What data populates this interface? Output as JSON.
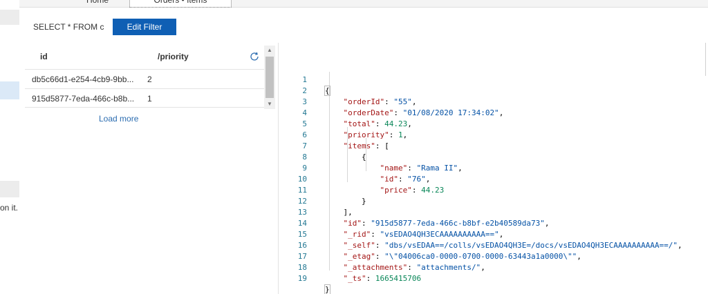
{
  "tabs": [
    {
      "label": "Home"
    },
    {
      "label": "Orders • Items"
    }
  ],
  "query": {
    "text": "SELECT * FROM c",
    "edit_filter_label": "Edit Filter"
  },
  "grid": {
    "columns": {
      "id": "id",
      "priority": "/priority"
    },
    "rows": [
      {
        "id": "db5c66d1-e254-4cb9-9bb...",
        "priority": "2"
      },
      {
        "id": "915d5877-7eda-466c-b8b...",
        "priority": "1"
      }
    ],
    "load_more": "Load more"
  },
  "left_panel": {
    "truncated_text": "on it."
  },
  "editor": {
    "lines": [
      {
        "n": "1"
      },
      {
        "n": "2"
      },
      {
        "n": "3"
      },
      {
        "n": "4"
      },
      {
        "n": "5"
      },
      {
        "n": "6"
      },
      {
        "n": "7"
      },
      {
        "n": "8"
      },
      {
        "n": "9"
      },
      {
        "n": "10"
      },
      {
        "n": "11"
      },
      {
        "n": "12"
      },
      {
        "n": "13"
      },
      {
        "n": "14"
      },
      {
        "n": "15"
      },
      {
        "n": "16"
      },
      {
        "n": "17"
      },
      {
        "n": "18"
      },
      {
        "n": "19"
      }
    ],
    "doc": {
      "orderId": "\"55\"",
      "orderDate": "\"01/08/2020 17:34:02\"",
      "total": "44.23",
      "priority": "1",
      "items_name": "\"Rama II\"",
      "items_id": "\"76\"",
      "items_price": "44.23",
      "id": "\"915d5877-7eda-466c-b8bf-e2b40589da73\"",
      "_rid": "\"vsEDAO4QH3ECAAAAAAAAAA==\"",
      "_self": "\"dbs/vsEDAA==/colls/vsEDAO4QH3E=/docs/vsEDAO4QH3ECAAAAAAAAAA==/\"",
      "_etag": "\"\\\"04006ca0-0000-0700-0000-63443a1a0000\\\"\"",
      "_attachments": "\"attachments/\"",
      "_ts": "1665415706"
    },
    "keys": {
      "orderId": "\"orderId\"",
      "orderDate": "\"orderDate\"",
      "total": "\"total\"",
      "priority": "\"priority\"",
      "items": "\"items\"",
      "name": "\"name\"",
      "item_id": "\"id\"",
      "price": "\"price\"",
      "id": "\"id\"",
      "_rid": "\"_rid\"",
      "_self": "\"_self\"",
      "_etag": "\"_etag\"",
      "_attachments": "\"_attachments\"",
      "_ts": "\"_ts\""
    }
  },
  "colors": {
    "accent": "#0f5fb4",
    "json_key": "#a31515",
    "json_string": "#0451a5",
    "json_number": "#098658",
    "line_number": "#237893"
  }
}
